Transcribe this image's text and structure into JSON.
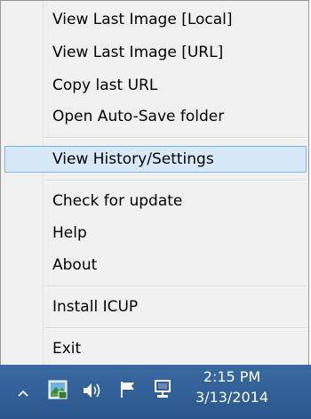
{
  "menu": {
    "items": [
      {
        "label": "View Last Image [Local]"
      },
      {
        "label": "View Last Image [URL]"
      },
      {
        "label": "Copy last URL"
      },
      {
        "label": "Open Auto-Save folder"
      },
      {
        "label": "View History/Settings"
      },
      {
        "label": "Check for update"
      },
      {
        "label": "Help"
      },
      {
        "label": "About"
      },
      {
        "label": "Install ICUP"
      },
      {
        "label": "Exit"
      }
    ],
    "highlighted_item": "View History/Settings"
  },
  "taskbar": {
    "tray_icons": [
      "chevron-up-icon",
      "app-tray-icon",
      "speaker-icon",
      "flag-icon",
      "network-icon"
    ],
    "clock": {
      "time": "2:15 PM",
      "date": "3/13/2014"
    }
  },
  "colors": {
    "menu_bg": "#f0f0f0",
    "highlight_bg": "#d7e9f8",
    "highlight_border": "#7fb4e3",
    "taskbar_bg": "#2e5c93"
  }
}
